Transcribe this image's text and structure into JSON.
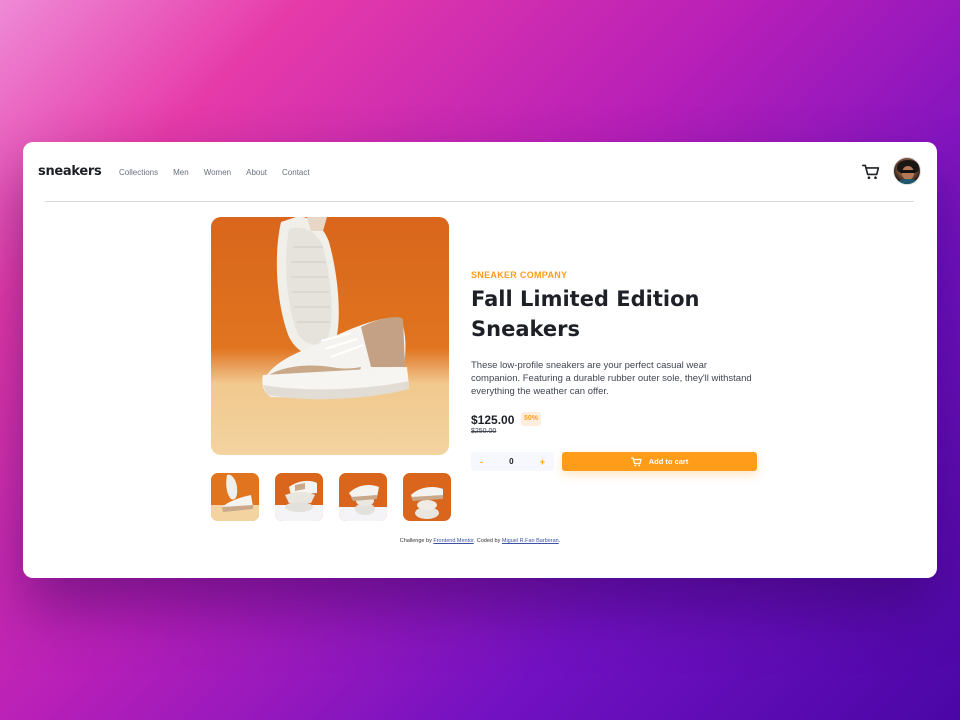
{
  "header": {
    "logo": "sneakers",
    "nav": [
      "Collections",
      "Men",
      "Women",
      "About",
      "Contact"
    ]
  },
  "icons": {
    "cart": "cart-icon",
    "avatar": "avatar",
    "minus": "minus-icon",
    "plus": "plus-icon"
  },
  "product": {
    "company": "SNEAKER COMPANY",
    "title_line1": "Fall Limited Edition",
    "title_line2": "Sneakers",
    "description": "These low-profile sneakers are your perfect casual wear companion. Featuring a durable rubber outer sole, they'll withstand everything the weather can offer.",
    "price": "$125.00",
    "discount": "50%",
    "old_price": "$250.00",
    "quantity": "0",
    "minus_label": "-",
    "plus_label": "+",
    "add_to_cart": "Add to cart"
  },
  "footer": {
    "prefix": "Challenge by ",
    "link1": "Frontend Mentor",
    "middle": ". Coded by ",
    "link2": "Miguel R.Fan Barberan",
    "suffix": "."
  },
  "colors": {
    "accent": "#ff9d1a",
    "accent_pale": "#ffeede",
    "dark": "#1d2026",
    "muted": "#69707d"
  }
}
